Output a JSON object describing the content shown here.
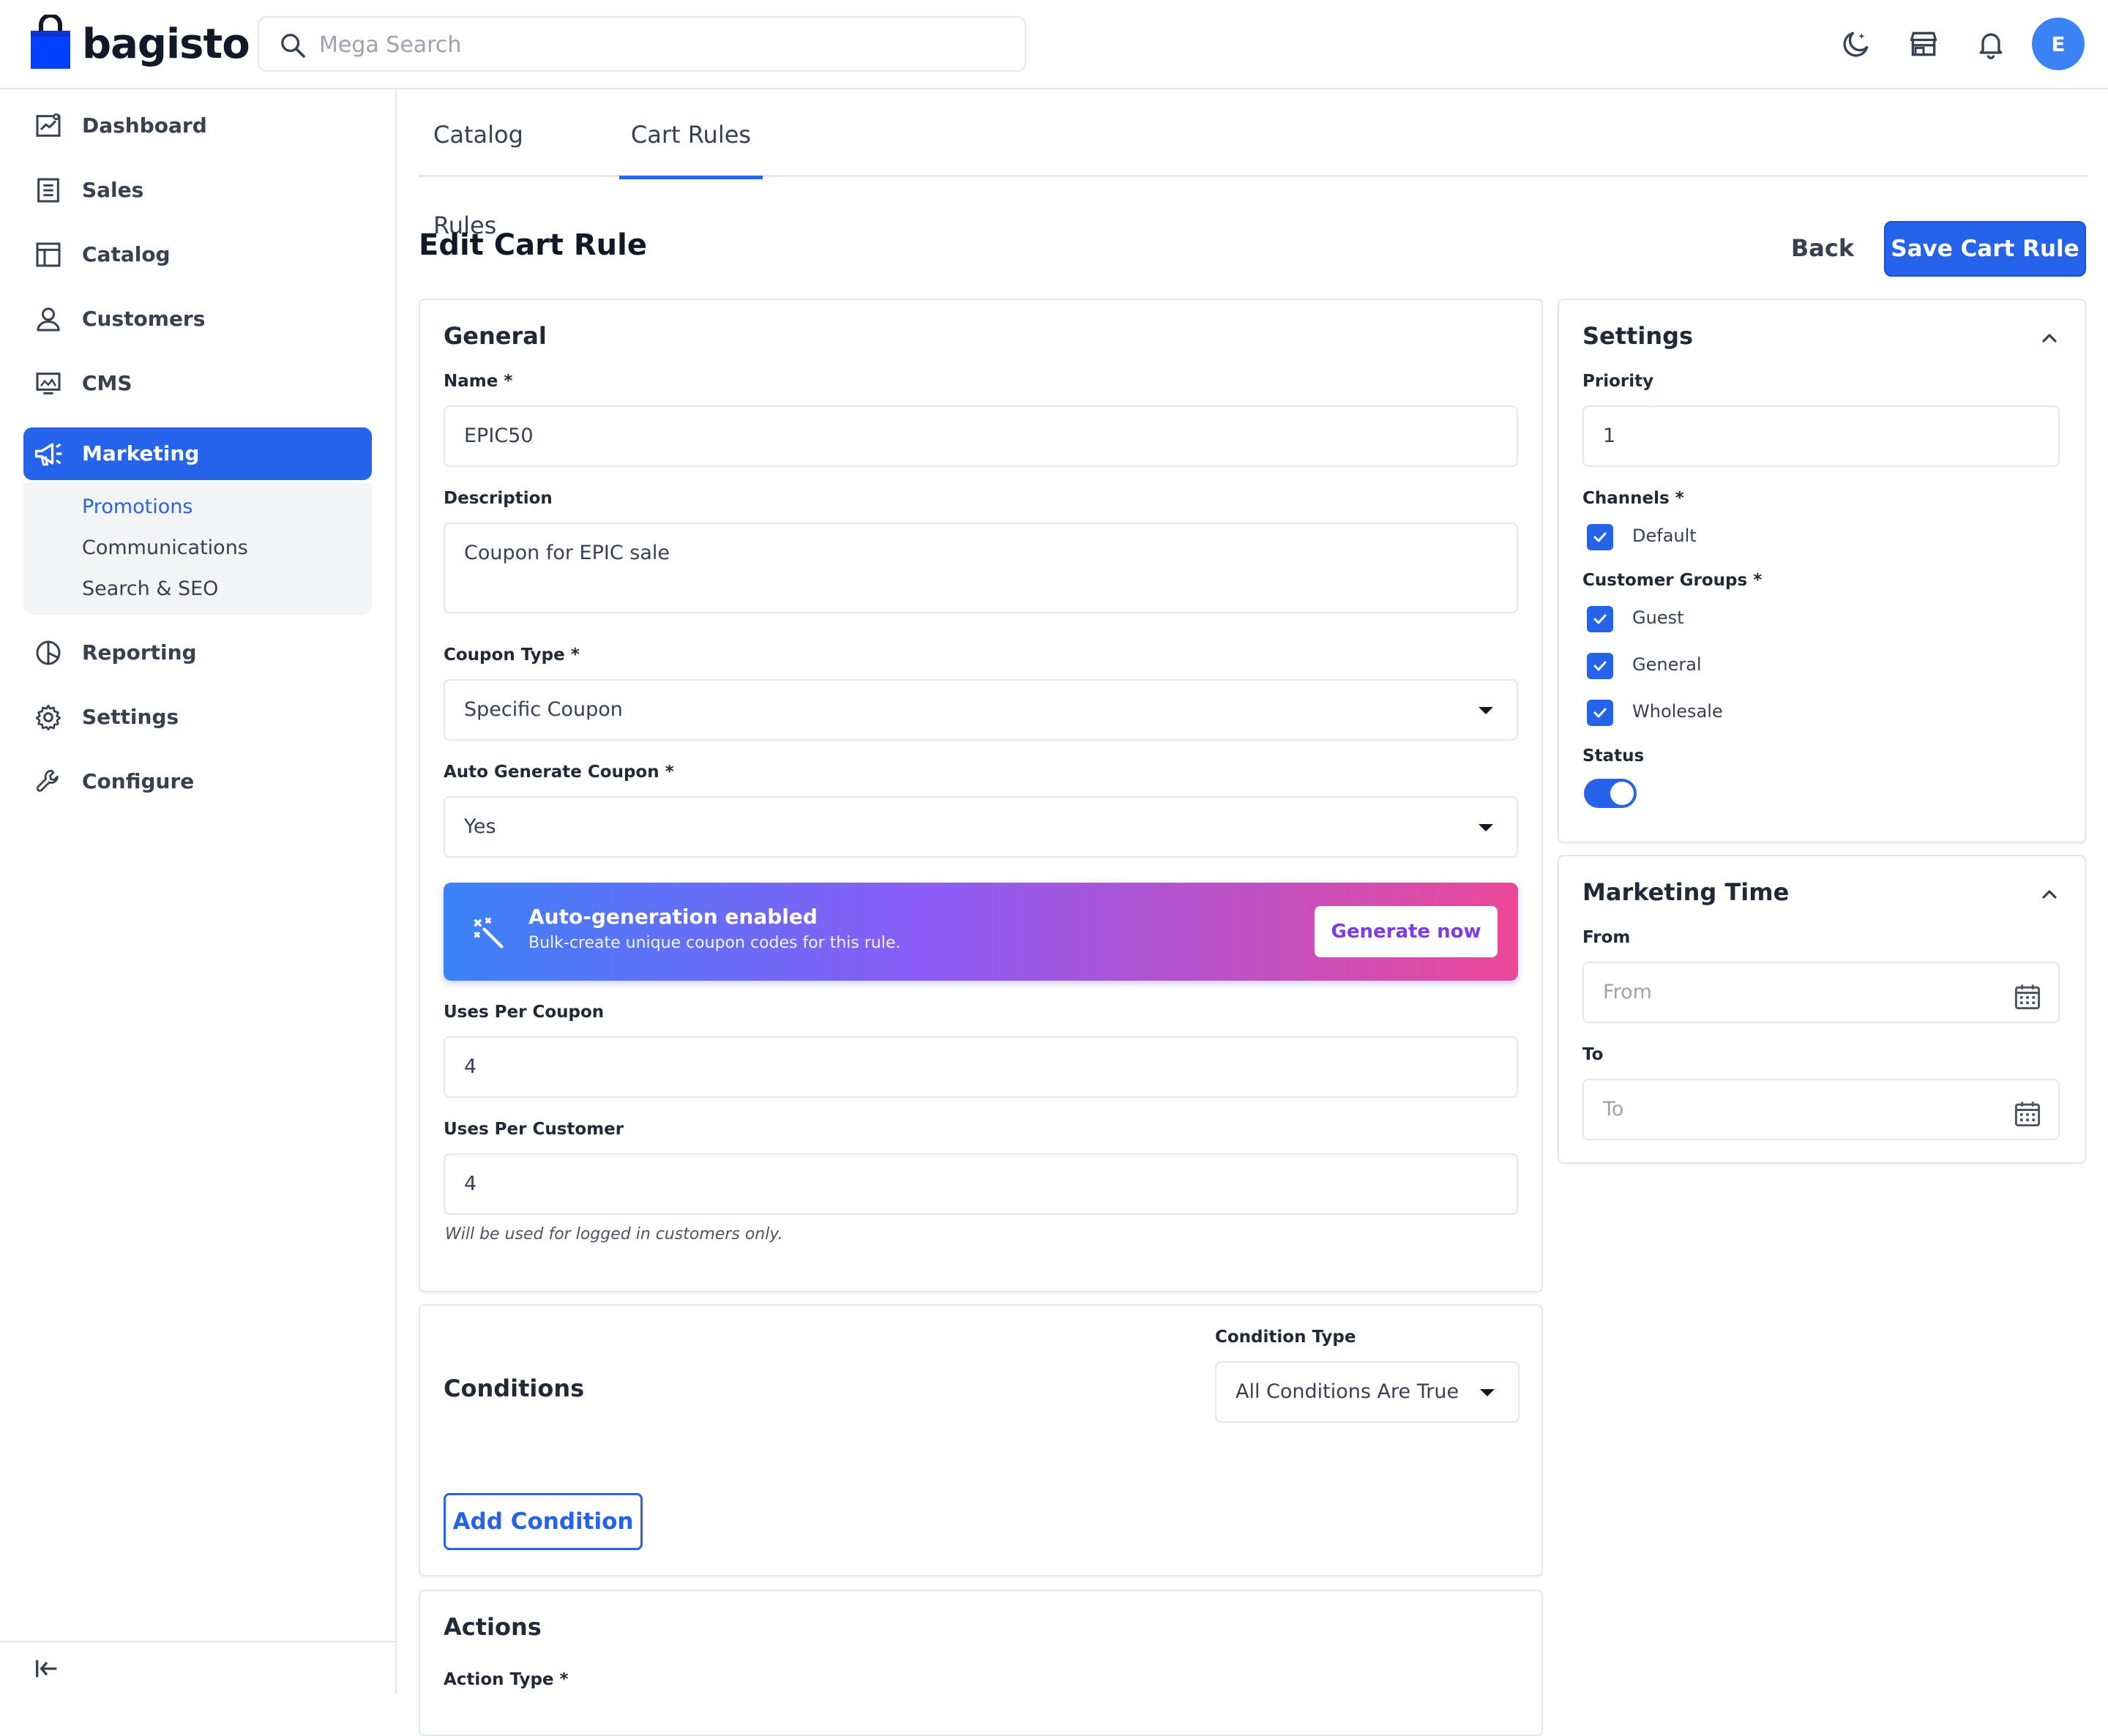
{
  "header": {
    "logo_text": "bagisto",
    "search_placeholder": "Mega Search",
    "avatar_initial": "E"
  },
  "sidebar": {
    "items": [
      {
        "label": "Dashboard",
        "icon": "dashboard-icon"
      },
      {
        "label": "Sales",
        "icon": "sales-icon"
      },
      {
        "label": "Catalog",
        "icon": "catalog-icon"
      },
      {
        "label": "Customers",
        "icon": "customers-icon"
      },
      {
        "label": "CMS",
        "icon": "cms-icon"
      },
      {
        "label": "Marketing",
        "icon": "marketing-icon",
        "active": true
      },
      {
        "label": "Reporting",
        "icon": "reporting-icon"
      },
      {
        "label": "Settings",
        "icon": "settings-icon"
      },
      {
        "label": "Configure",
        "icon": "configure-icon"
      }
    ],
    "marketing_submenu": [
      "Promotions",
      "Communications",
      "Search & SEO"
    ]
  },
  "tabs": [
    "Catalog Rules",
    "Cart Rules"
  ],
  "page": {
    "title": "Edit Cart Rule",
    "back_label": "Back",
    "save_label": "Save Cart Rule"
  },
  "general": {
    "title": "General",
    "name_label": "Name *",
    "name_value": "EPIC50",
    "description_label": "Description",
    "description_value": "Coupon for EPIC sale",
    "coupon_type_label": "Coupon Type *",
    "coupon_type_value": "Specific Coupon",
    "auto_generate_label": "Auto Generate Coupon *",
    "auto_generate_value": "Yes",
    "banner": {
      "title": "Auto-generation enabled",
      "subtitle": "Bulk-create unique coupon codes for this rule.",
      "button": "Generate now"
    },
    "uses_per_coupon_label": "Uses Per Coupon",
    "uses_per_coupon_value": "4",
    "uses_per_customer_label": "Uses Per Customer",
    "uses_per_customer_value": "4",
    "uses_per_customer_hint": "Will be used for logged in customers only."
  },
  "conditions": {
    "title": "Conditions",
    "condition_type_label": "Condition Type",
    "condition_type_value": "All Conditions Are True",
    "add_button": "Add Condition"
  },
  "actions": {
    "title": "Actions",
    "action_type_label": "Action Type *"
  },
  "settings": {
    "title": "Settings",
    "priority_label": "Priority",
    "priority_value": "1",
    "channels_label": "Channels *",
    "channels": [
      "Default"
    ],
    "customer_groups_label": "Customer Groups *",
    "customer_groups": [
      "Guest",
      "General",
      "Wholesale"
    ],
    "status_label": "Status",
    "status_on": true
  },
  "marketing_time": {
    "title": "Marketing Time",
    "from_label": "From",
    "from_placeholder": "From",
    "to_label": "To",
    "to_placeholder": "To"
  },
  "colors": {
    "primary": "#2563eb",
    "banner_gradient": [
      "#3b82f6",
      "#8b5cf6",
      "#ec4899"
    ]
  }
}
